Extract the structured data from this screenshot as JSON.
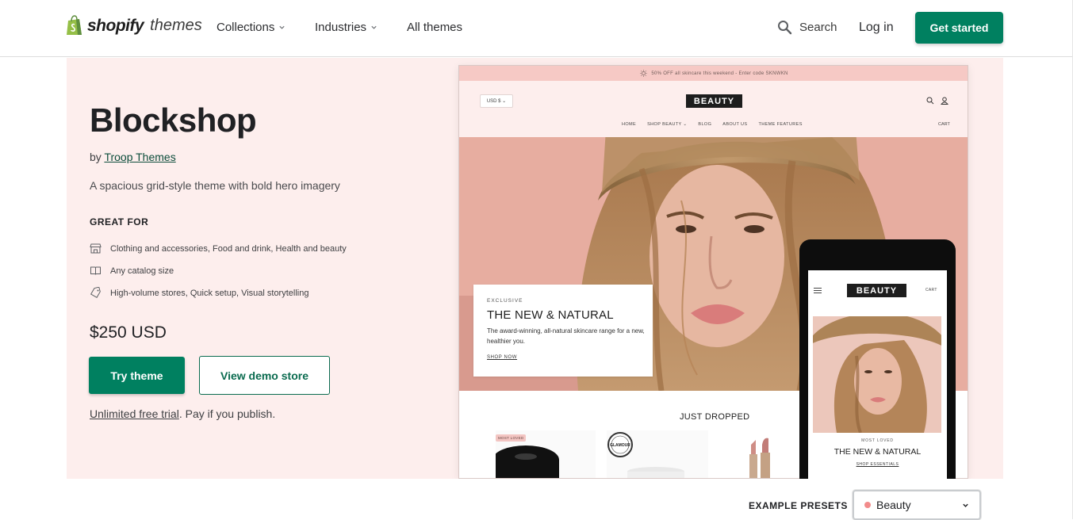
{
  "header": {
    "logo_word": "shopify",
    "logo_suffix": "themes",
    "nav": [
      "Collections",
      "Industries",
      "All themes"
    ],
    "search_label": "Search",
    "login_label": "Log in",
    "cta_label": "Get started",
    "brand_color": "#008060"
  },
  "theme": {
    "name": "Blockshop",
    "by_prefix": "by",
    "author": "Troop Themes",
    "tagline": "A spacious grid-style theme with bold hero imagery",
    "great_for_heading": "GREAT FOR",
    "features": [
      {
        "icon": "store-icon",
        "text": "Clothing and accessories, Food and drink, Health and beauty"
      },
      {
        "icon": "catalog-icon",
        "text": "Any catalog size"
      },
      {
        "icon": "tag-icon",
        "text": "High-volume stores, Quick setup, Visual storytelling"
      }
    ],
    "price": "$250 USD",
    "try_label": "Try theme",
    "demo_label": "View demo store",
    "trial_link": "Unlimited free trial",
    "trial_rest": ". Pay if you publish."
  },
  "preview": {
    "announcement": "50% OFF all skincare this weekend - Enter code SKNWKN",
    "currency": "USD $",
    "store_logo": "BEAUTY",
    "nav": [
      "HOME",
      "SHOP BEAUTY",
      "BLOG",
      "ABOUT US",
      "THEME FEATURES"
    ],
    "cart": "CART",
    "card_kicker": "EXCLUSIVE",
    "card_heading": "THE NEW & NATURAL",
    "card_text": "The award-winning, all-natural skincare range for a new, healthier you.",
    "card_link": "SHOP NOW",
    "section_title": "JUST DROPPED",
    "badge": "MOST LOVED",
    "seal_text": "GLAMOUR"
  },
  "mobile_preview": {
    "store_logo": "BEAUTY",
    "cart": "CART",
    "kicker": "MOST LOVED",
    "heading": "THE NEW & NATURAL",
    "link": "SHOP ESSENTIALS"
  },
  "presets": {
    "label": "EXAMPLE PRESETS",
    "selected": "Beauty",
    "dot_color": "#f28b8b"
  }
}
